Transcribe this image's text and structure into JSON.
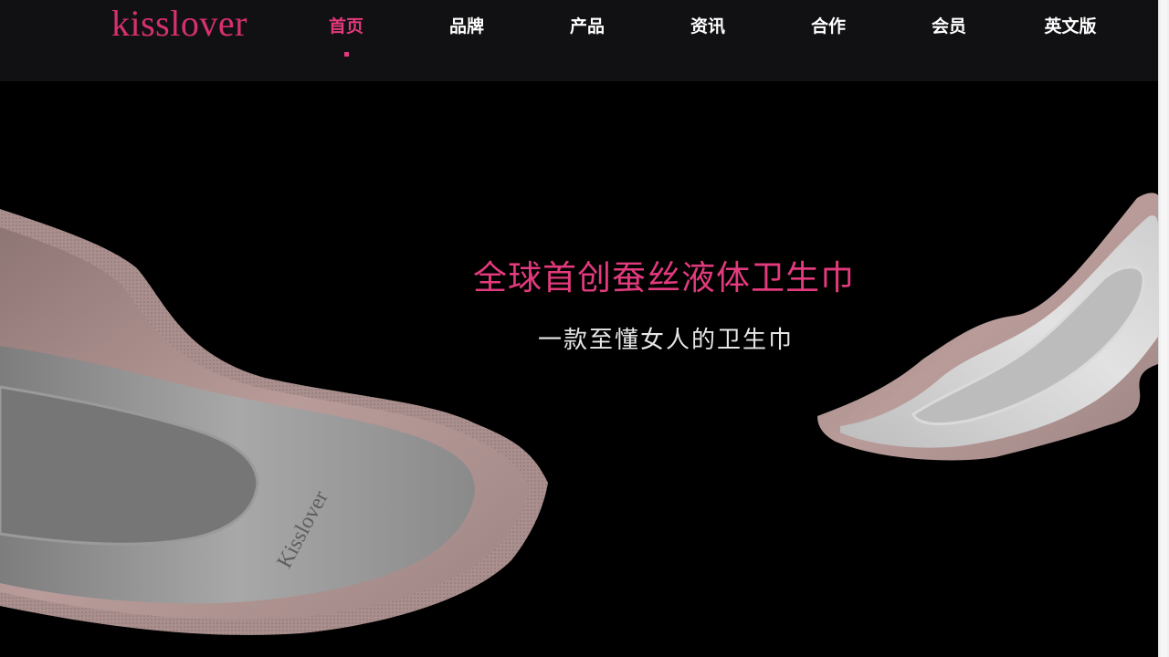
{
  "brand": {
    "logo_text": "kisslover",
    "accent_color": "#e23a7d"
  },
  "nav": {
    "items": [
      {
        "label": "首页",
        "active": true
      },
      {
        "label": "品牌"
      },
      {
        "label": "产品"
      },
      {
        "label": "资讯"
      },
      {
        "label": "合作"
      },
      {
        "label": "会员"
      },
      {
        "label": "英文版"
      }
    ]
  },
  "hero": {
    "headline": "全球首创蚕丝液体卫生巾",
    "subline": "一款至懂女人的卫生巾",
    "product_imprint": "Kisslover"
  },
  "icons": {
    "product_image_left": "sanitary-pad-image",
    "product_image_right": "sanitary-pad-image"
  }
}
